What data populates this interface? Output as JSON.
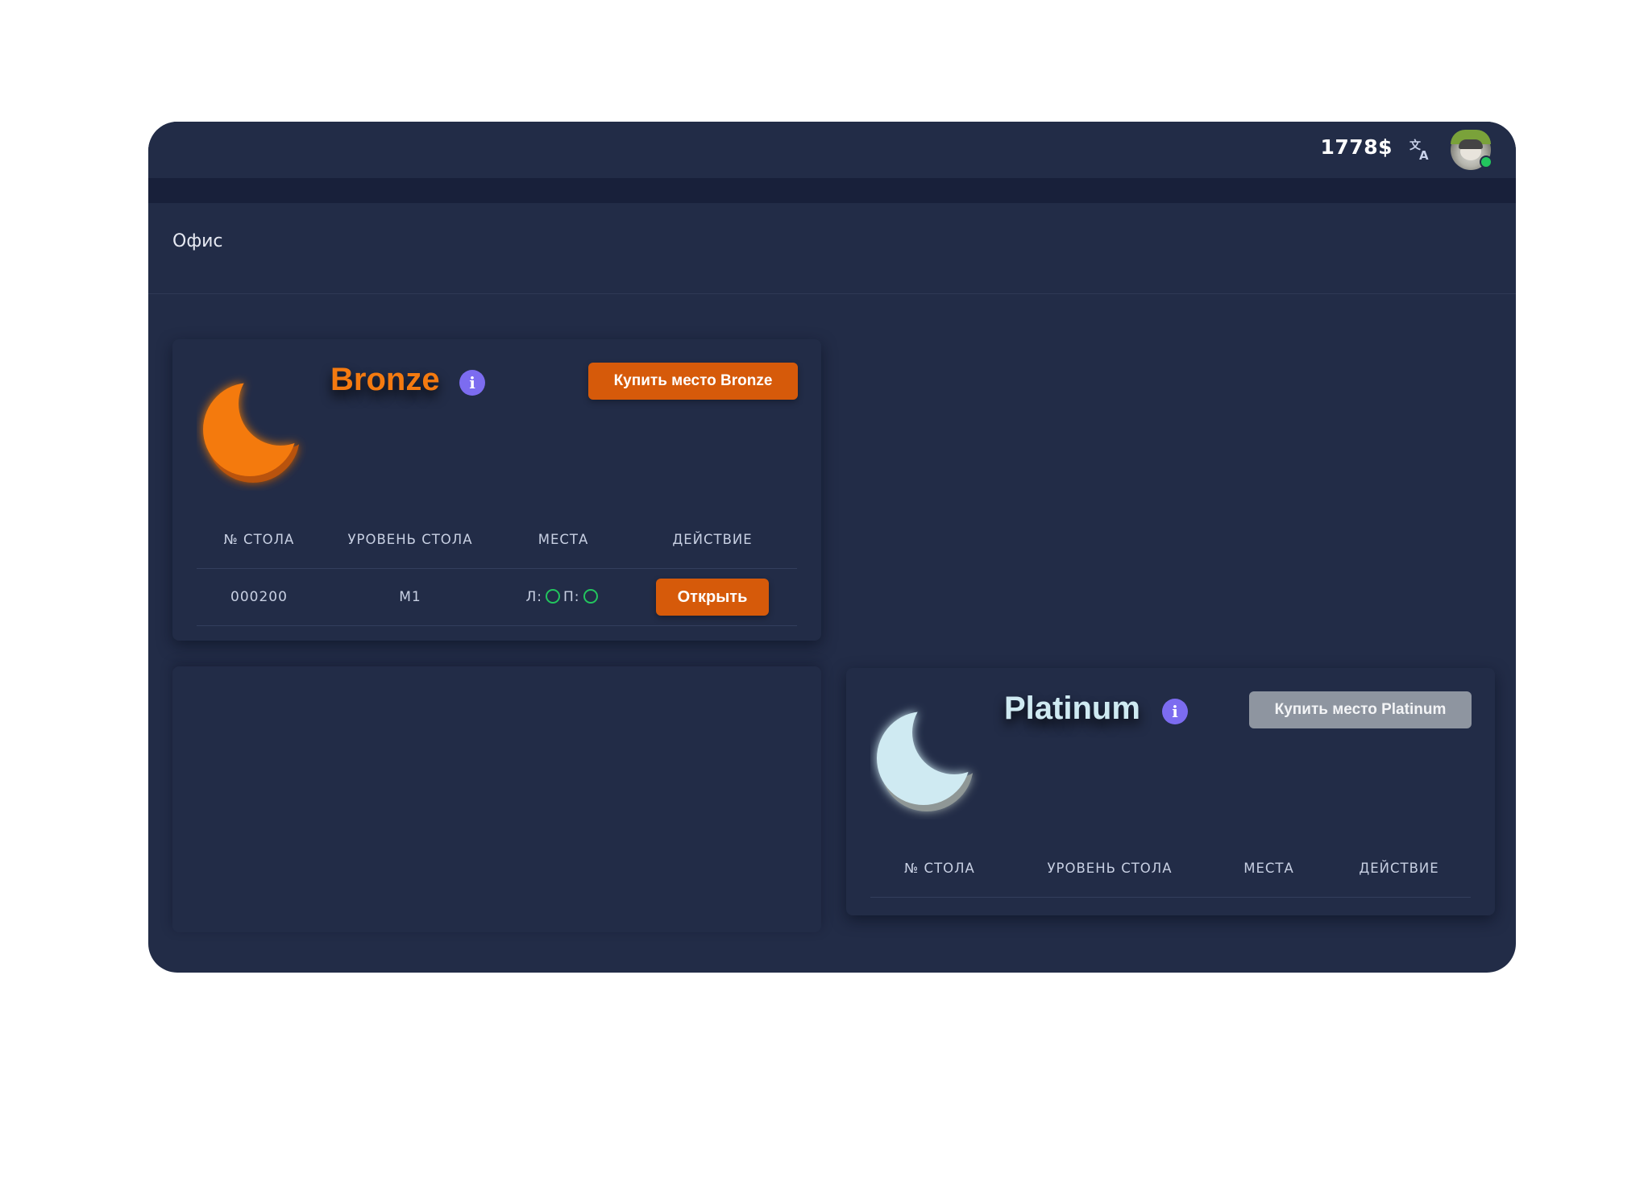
{
  "header": {
    "balance": "1778$",
    "translate_icon": "translate-icon",
    "avatar_status": "online"
  },
  "page": {
    "title": "Офис"
  },
  "tiers": [
    {
      "name": "Bronze",
      "color": "#f47a10",
      "moon_icon": "crescent-moon-icon",
      "buy_label": "Купить место Bronze",
      "buy_enabled": true,
      "columns": [
        "№ СТОЛА",
        "УРОВЕНЬ СТОЛА",
        "МЕСТА",
        "ДЕЙСТВИЕ"
      ],
      "rows": [
        {
          "table_no": "000200",
          "level": "M1",
          "seats_left_label": "Л:",
          "seats_right_label": "П:",
          "action_label": "Открыть"
        }
      ]
    },
    {
      "name": "Platinum",
      "color": "#cfeaf2",
      "moon_icon": "crescent-moon-icon",
      "buy_label": "Купить место Platinum",
      "buy_enabled": false,
      "columns": [
        "№ СТОЛА",
        "УРОВЕНЬ СТОЛА",
        "МЕСТА",
        "ДЕЙСТВИЕ"
      ],
      "rows": []
    }
  ],
  "colors": {
    "background": "#222c47",
    "accent_orange": "#d65a0a",
    "info_purple": "#7c6cf0",
    "seat_green": "#22c55e",
    "disabled_gray": "#8e95a0"
  }
}
